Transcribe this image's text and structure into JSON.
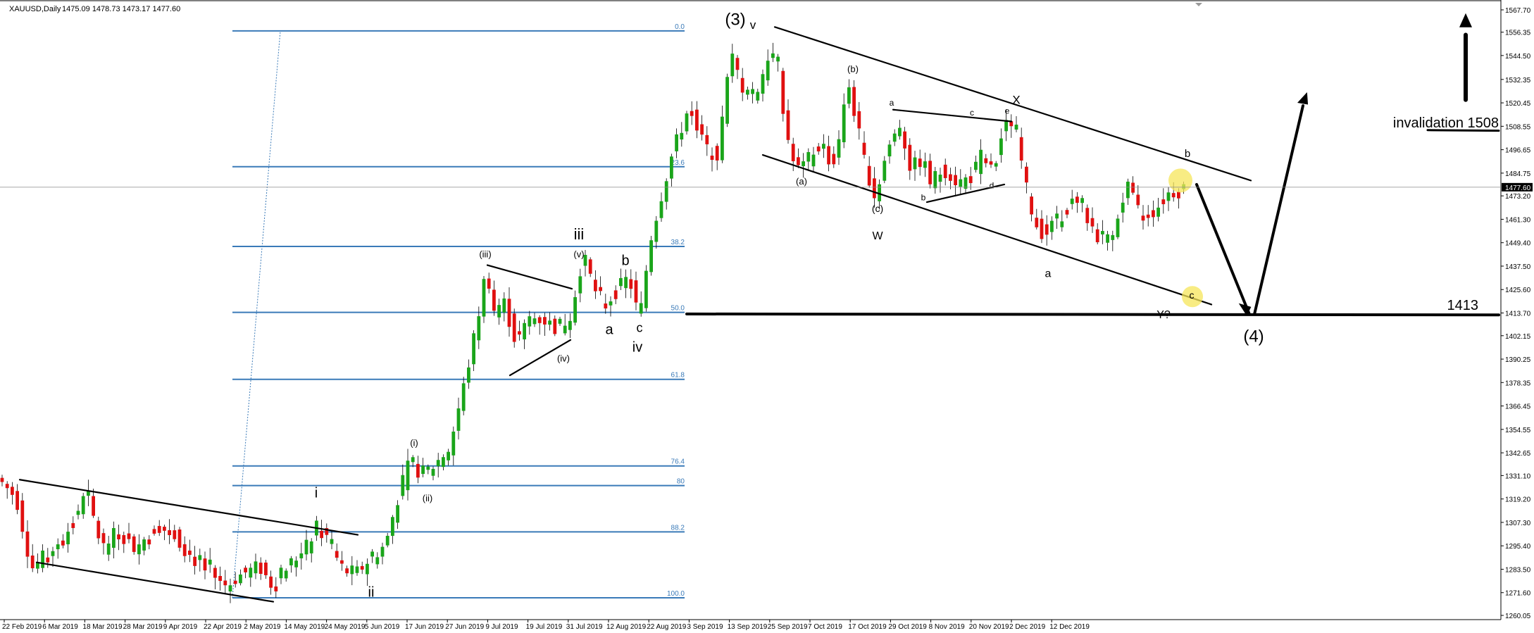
{
  "chart_data": {
    "type": "candlestick",
    "symbol": "XAUUSD,Daily",
    "ohlc_header": "1475.09 1478.73 1473.17 1477.60",
    "last_price": "1477.60",
    "colors": {
      "up": "#1aa51a",
      "down": "#e01010",
      "fib": "#3a7ab8",
      "annotation": "#f5e65a",
      "grid_price": "#8a8a8a"
    },
    "ylim": [
      1260.05,
      1567.7
    ],
    "y_ticks": [
      "1567.70",
      "1556.35",
      "1544.50",
      "1532.35",
      "1520.45",
      "1508.55",
      "1496.65",
      "1484.75",
      "1473.20",
      "1461.30",
      "1449.40",
      "1437.50",
      "1425.60",
      "1413.70",
      "1402.15",
      "1390.25",
      "1378.35",
      "1366.45",
      "1354.55",
      "1342.65",
      "1331.10",
      "1319.20",
      "1307.30",
      "1295.40",
      "1283.50",
      "1271.60",
      "1260.05"
    ],
    "x_ticks": [
      "22 Feb 2019",
      "6 Mar 2019",
      "18 Mar 2019",
      "28 Mar 2019",
      "9 Apr 2019",
      "22 Apr 2019",
      "2 May 2019",
      "14 May 2019",
      "24 May 2019",
      "5 Jun 2019",
      "17 Jun 2019",
      "27 Jun 2019",
      "9 Jul 2019",
      "19 Jul 2019",
      "31 Jul 2019",
      "12 Aug 2019",
      "22 Aug 2019",
      "3 Sep 2019",
      "13 Sep 2019",
      "25 Sep 2019",
      "7 Oct 2019",
      "17 Oct 2019",
      "29 Oct 2019",
      "8 Nov 2019",
      "20 Nov 2019",
      "2 Dec 2019",
      "12 Dec 2019"
    ],
    "fibonacci": [
      {
        "label": "0.0",
        "price": 1557.0
      },
      {
        "label": "23.6",
        "price": 1488.0
      },
      {
        "label": "38.2",
        "price": 1447.5
      },
      {
        "label": "50.0",
        "price": 1414.0
      },
      {
        "label": "61.8",
        "price": 1380.0
      },
      {
        "label": "76.4",
        "price": 1336.0
      },
      {
        "label": "80",
        "price": 1326.0
      },
      {
        "label": "88.2",
        "price": 1302.5
      },
      {
        "label": "100.0",
        "price": 1269.0
      }
    ],
    "levels": [
      {
        "label": "1413",
        "price": 1413.2
      },
      {
        "label": "invalidation 1508",
        "price": 1506.5
      }
    ],
    "wave_labels": [
      "i",
      "ii",
      "iii",
      "iv",
      "(i)",
      "(ii)",
      "(iii)",
      "(iv)",
      "(v)",
      "a",
      "b",
      "c",
      "(3)",
      "v",
      "(a)",
      "(b)",
      "(c)",
      "W",
      "a",
      "b",
      "c",
      "d",
      "e",
      "X",
      "a",
      "b",
      "c",
      "Y?",
      "(4)"
    ]
  }
}
